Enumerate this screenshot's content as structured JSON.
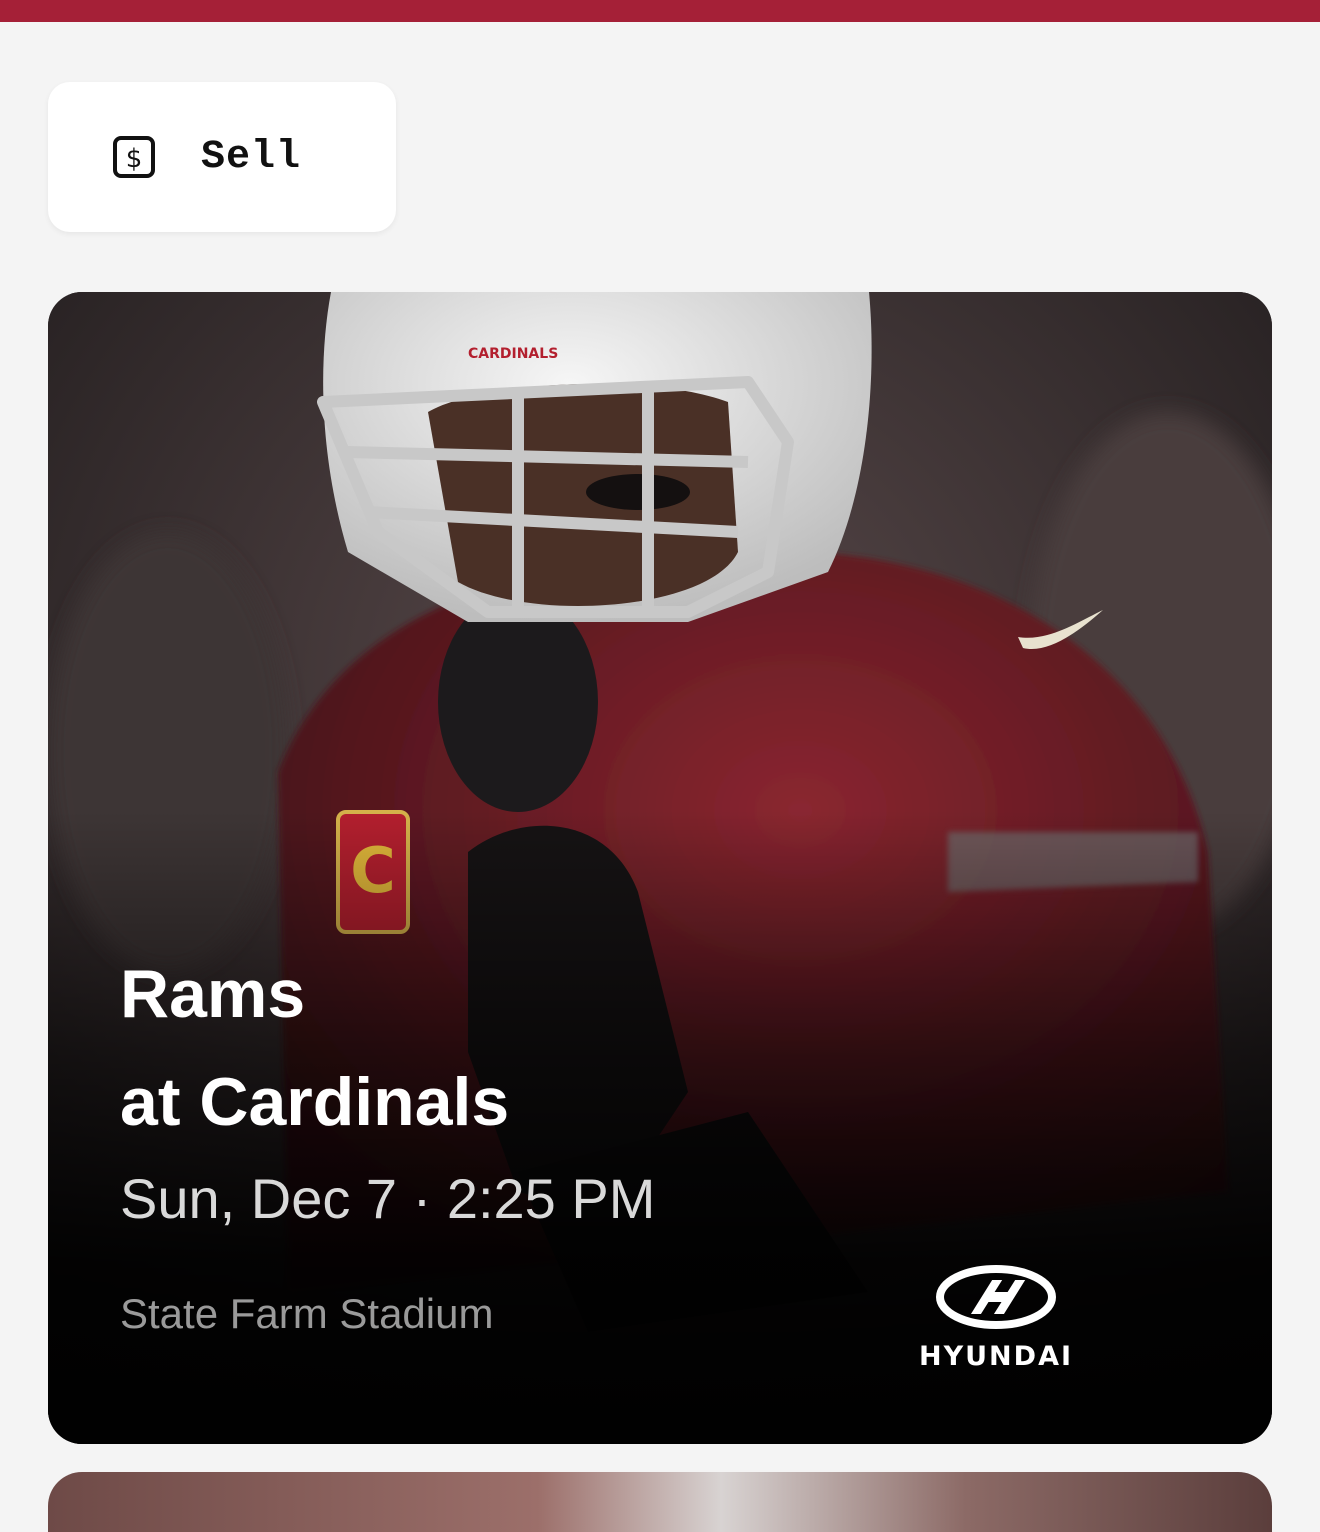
{
  "header": {
    "accent_color": "#a52037"
  },
  "sell_button": {
    "icon": "dollar-sign-icon",
    "label": "Sell"
  },
  "event_card": {
    "title_line1": "Rams",
    "title_line2": "at Cardinals",
    "datetime": "Sun, Dec 7 · 2:25 PM",
    "venue": "State Farm Stadium",
    "sponsor": {
      "icon": "hyundai-logo-icon",
      "name": "HYUNDAI"
    }
  }
}
